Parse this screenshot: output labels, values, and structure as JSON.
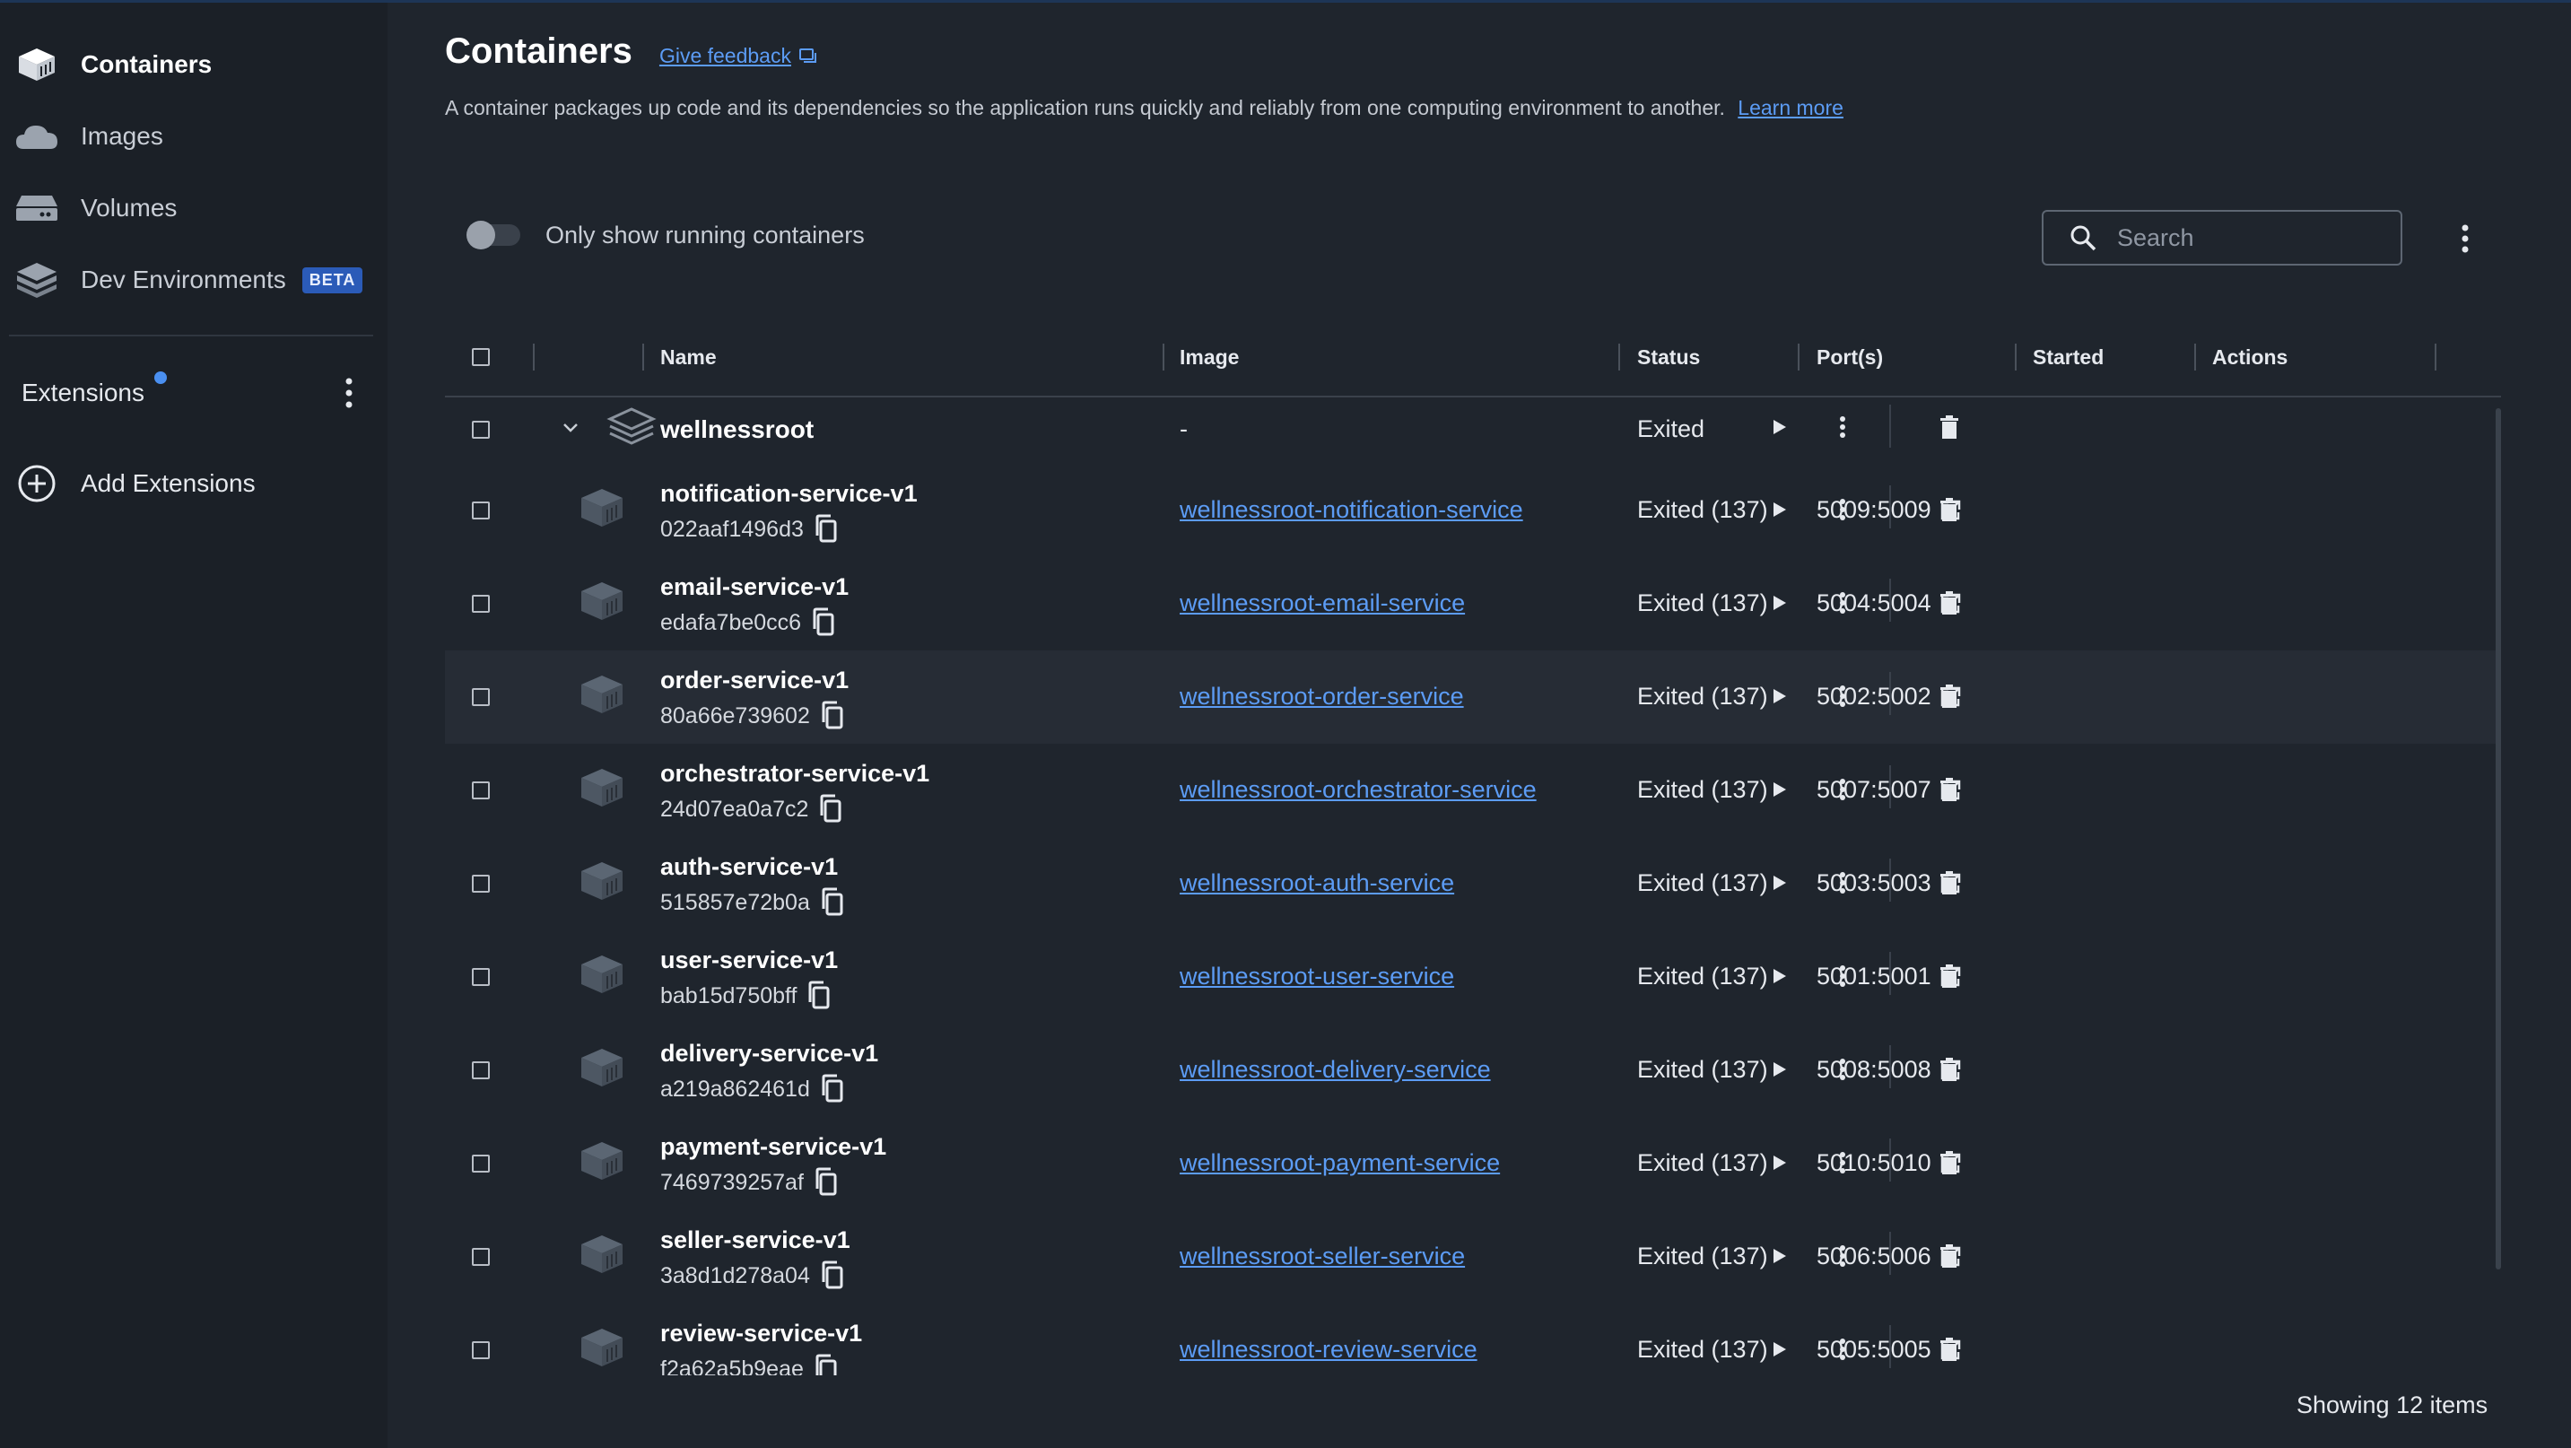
{
  "sidebar": {
    "items": [
      {
        "label": "Containers",
        "icon": "containers-icon"
      },
      {
        "label": "Images",
        "icon": "images-icon"
      },
      {
        "label": "Volumes",
        "icon": "volumes-icon"
      },
      {
        "label": "Dev Environments",
        "icon": "dev-environments-icon",
        "badge": "BETA"
      }
    ],
    "extensions_label": "Extensions",
    "add_extensions_label": "Add Extensions"
  },
  "header": {
    "title": "Containers",
    "feedback_label": "Give feedback",
    "description": "A container packages up code and its dependencies so the application runs quickly and reliably from one computing environment to another.",
    "learn_more": "Learn more"
  },
  "toolbar": {
    "toggle_label": "Only show running containers",
    "toggle_on": false,
    "search_placeholder": "Search"
  },
  "table": {
    "columns": {
      "name": "Name",
      "image": "Image",
      "status": "Status",
      "ports": "Port(s)",
      "started": "Started",
      "actions": "Actions"
    },
    "group": {
      "name": "wellnessroot",
      "image": "-",
      "status": "Exited"
    },
    "rows": [
      {
        "name": "notification-service-v1",
        "id": "022aaf1496d3",
        "image": "wellnessroot-notification-service",
        "status": "Exited (137)",
        "port": "5009:5009"
      },
      {
        "name": "email-service-v1",
        "id": "edafa7be0cc6",
        "image": "wellnessroot-email-service",
        "status": "Exited (137)",
        "port": "5004:5004"
      },
      {
        "name": "order-service-v1",
        "id": "80a66e739602",
        "image": "wellnessroot-order-service",
        "status": "Exited (137)",
        "port": "5002:5002"
      },
      {
        "name": "orchestrator-service-v1",
        "id": "24d07ea0a7c2",
        "image": "wellnessroot-orchestrator-service",
        "status": "Exited (137)",
        "port": "5007:5007"
      },
      {
        "name": "auth-service-v1",
        "id": "515857e72b0a",
        "image": "wellnessroot-auth-service",
        "status": "Exited (137)",
        "port": "5003:5003"
      },
      {
        "name": "user-service-v1",
        "id": "bab15d750bff",
        "image": "wellnessroot-user-service",
        "status": "Exited (137)",
        "port": "5001:5001"
      },
      {
        "name": "delivery-service-v1",
        "id": "a219a862461d",
        "image": "wellnessroot-delivery-service",
        "status": "Exited (137)",
        "port": "5008:5008"
      },
      {
        "name": "payment-service-v1",
        "id": "7469739257af",
        "image": "wellnessroot-payment-service",
        "status": "Exited (137)",
        "port": "5010:5010"
      },
      {
        "name": "seller-service-v1",
        "id": "3a8d1d278a04",
        "image": "wellnessroot-seller-service",
        "status": "Exited (137)",
        "port": "5006:5006"
      },
      {
        "name": "review-service-v1",
        "id": "f2a62a5b9eae",
        "image": "wellnessroot-review-service",
        "status": "Exited (137)",
        "port": "5005:5005"
      }
    ]
  },
  "footer": {
    "showing": "Showing 12 items"
  },
  "colors": {
    "accent": "#5c9cf5",
    "badge": "#2b5bb8",
    "background": "#1f252d",
    "sidebar": "#1b2027"
  }
}
